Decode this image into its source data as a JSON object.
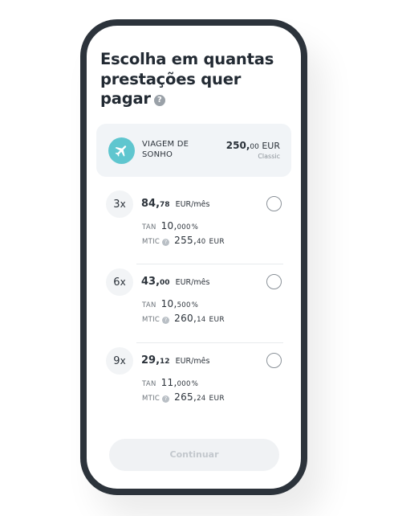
{
  "title": "Escolha em quantas prestações quer pagar",
  "title_help_icon": "help-icon",
  "product": {
    "icon": "airplane-icon",
    "name": "VIAGEM DE SONHO",
    "amount_int": "250,",
    "amount_dec": "00",
    "currency": "EUR",
    "type": "Classic"
  },
  "options": [
    {
      "count": "3",
      "x": "x",
      "monthly_int": "84,",
      "monthly_dec": "78",
      "monthly_unit": "EUR/mês",
      "tan_label": "TAN",
      "tan_int": "10,",
      "tan_dec": "000",
      "tan_pct": "%",
      "mtic_label": "MTIC",
      "mtic_int": "255,",
      "mtic_dec": "40",
      "mtic_cur": "EUR"
    },
    {
      "count": "6",
      "x": "x",
      "monthly_int": "43,",
      "monthly_dec": "00",
      "monthly_unit": "EUR/mês",
      "tan_label": "TAN",
      "tan_int": "10,",
      "tan_dec": "500",
      "tan_pct": "%",
      "mtic_label": "MTIC",
      "mtic_int": "260,",
      "mtic_dec": "14",
      "mtic_cur": "EUR"
    },
    {
      "count": "9",
      "x": "x",
      "monthly_int": "29,",
      "monthly_dec": "12",
      "monthly_unit": "EUR/mês",
      "tan_label": "TAN",
      "tan_int": "11,",
      "tan_dec": "000",
      "tan_pct": "%",
      "mtic_label": "MTIC",
      "mtic_int": "265,",
      "mtic_dec": "24",
      "mtic_cur": "EUR"
    }
  ],
  "continue_label": "Continuar",
  "colors": {
    "frame": "#2c333b",
    "accent": "#5fc6cf",
    "card_bg": "#f1f4f7",
    "disabled_text": "#c3c8cd"
  }
}
